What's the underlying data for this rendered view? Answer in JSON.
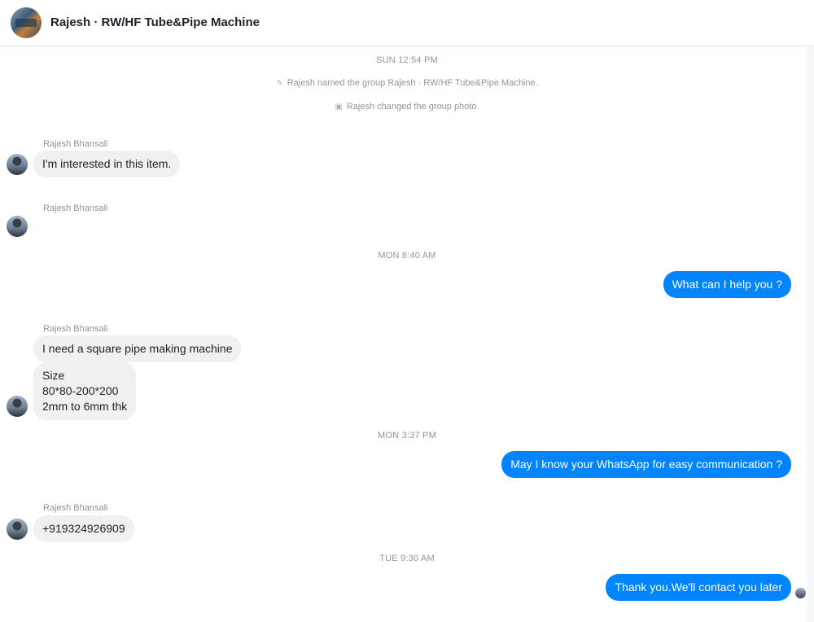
{
  "header": {
    "title": "Rajesh · RW/HF Tube&Pipe Machine"
  },
  "messages": {
    "ts1": "SUN 12:54 PM",
    "sys1": "Rajesh named the group Rajesh · RW/HF Tube&Pipe Machine.",
    "sys2": "Rajesh changed the group photo.",
    "sender1": "Rajesh Bhansali",
    "in1": "I'm interested in this item.",
    "sender2": "Rajesh Bhansali",
    "ts2": "MON 8:40 AM",
    "out1": "What can I help you ?",
    "sender3": "Rajesh Bhansali",
    "in2": "I need a square pipe making machine",
    "in3_line1": "Size",
    "in3_line2": "80*80-200*200",
    "in3_line3": "2mm to 6mm thk",
    "ts3": "MON 3:37 PM",
    "out2": "May I know your WhatsApp for easy communication ?",
    "sender4": "Rajesh Bhansali",
    "in4": "+919324926909",
    "ts4": "TUE 9:30 AM",
    "out3": "Thank you.We'll contact you later"
  },
  "icons": {
    "rename": "pencil-icon",
    "photo": "photo-icon"
  },
  "colors": {
    "outgoing_bubble": "#0084ff",
    "incoming_bubble": "#f1f0f0",
    "timestamp": "#90949c"
  }
}
